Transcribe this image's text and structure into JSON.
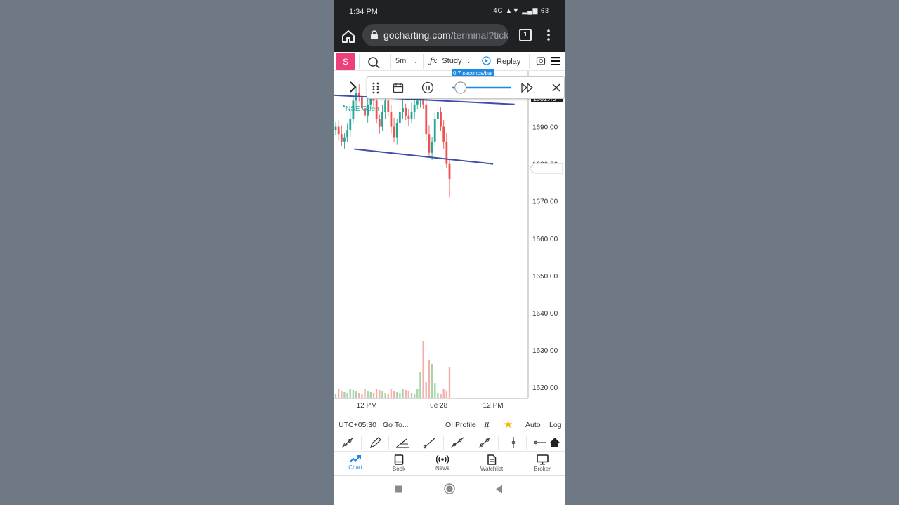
{
  "status_bar": {
    "time": "1:34 PM",
    "indicators": "4G ▲▼ ▂▄▆ 63"
  },
  "browser": {
    "url_host": "gocharting.com",
    "url_path": "/terminal?tick",
    "tab_count": "1"
  },
  "toolbar": {
    "avatar": "S",
    "interval": "5m",
    "study_label": "Study",
    "replay_label": "Replay"
  },
  "replay_controls": {
    "speed_tooltip": "0.7 seconds/bar",
    "speed_fraction": 0.14
  },
  "chart": {
    "market_status": "NSE Open",
    "price_axis": [
      "1700.00",
      "1690.00",
      "1680.00",
      "1670.00",
      "1660.00",
      "1650.00",
      "1640.00",
      "1630.00",
      "1620.00"
    ],
    "time_axis": [
      "12 PM",
      "Tue 28",
      "12 PM"
    ],
    "price_label_fragment": "1681.45"
  },
  "chart_data": {
    "type": "candlestick",
    "y_ticks": [
      1700,
      1690,
      1680,
      1670,
      1660,
      1650,
      1640,
      1630,
      1620
    ],
    "x_ticks": [
      "12 PM",
      "Tue 28",
      "12 PM"
    ],
    "ylim": [
      1617,
      1705
    ],
    "up_color": "#26a69a",
    "down_color": "#ef5350",
    "closes_approx": [
      1690,
      1688,
      1686,
      1687,
      1689,
      1692,
      1697,
      1699,
      1698,
      1695,
      1693,
      1696,
      1698,
      1697,
      1692,
      1690,
      1694,
      1697,
      1694,
      1690,
      1687,
      1691,
      1694,
      1695,
      1693,
      1692,
      1694,
      1696,
      1697,
      1698,
      1696,
      1688,
      1683,
      1686,
      1692,
      1694,
      1690,
      1686,
      1680,
      1676
    ],
    "trendlines": [
      {
        "from": [
          1699,
          0.28
        ],
        "to": [
          1696,
          0.93
        ]
      },
      {
        "from": [
          1684,
          0.1
        ],
        "to": [
          1680,
          0.82
        ]
      }
    ]
  },
  "bottom_bar": {
    "timezone": "UTC+05:30",
    "goto": "Go To...",
    "oi_profile": "OI Profile",
    "auto": "Auto",
    "log": "Log"
  },
  "nav": {
    "chart": "Chart",
    "book": "Book",
    "news": "News",
    "watchlist": "Watchlist",
    "broker": "Broker"
  },
  "colors": {
    "accent": "#1e88e5",
    "avatar": "#ec407a",
    "trendline": "#3f4fa8"
  }
}
